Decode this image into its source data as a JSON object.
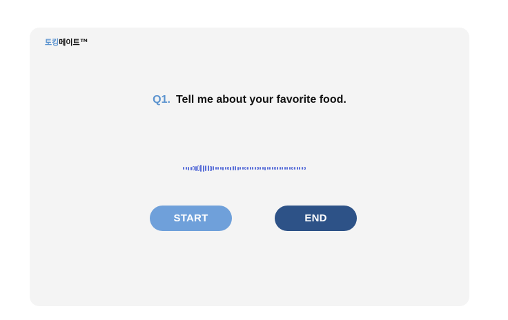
{
  "brand": {
    "accent_text": "토킹",
    "main_text": "메이트",
    "trademark": "TM"
  },
  "question": {
    "number": "Q1.",
    "text": "Tell me about your favorite food."
  },
  "waveform": {
    "color": "#5a6fd8",
    "levels": [
      0.25,
      0.3,
      0.35,
      0.35,
      0.45,
      0.5,
      0.6,
      0.7,
      0.65,
      0.6,
      0.55,
      0.5,
      0.4,
      0.3,
      0.3,
      0.3,
      0.35,
      0.3,
      0.3,
      0.35,
      0.45,
      0.4,
      0.35,
      0.3,
      0.25,
      0.25,
      0.25,
      0.3,
      0.25,
      0.25,
      0.3,
      0.3,
      0.3,
      0.35,
      0.3,
      0.3,
      0.25,
      0.3,
      0.3,
      0.25,
      0.25,
      0.25,
      0.3,
      0.25,
      0.25,
      0.3,
      0.25,
      0.25,
      0.25,
      0.25
    ]
  },
  "buttons": {
    "start_label": "START",
    "end_label": "END"
  },
  "colors": {
    "accent": "#5b93cf",
    "start_button": "#6fa0da",
    "end_button": "#2d5287",
    "card_background": "#f4f4f4"
  }
}
